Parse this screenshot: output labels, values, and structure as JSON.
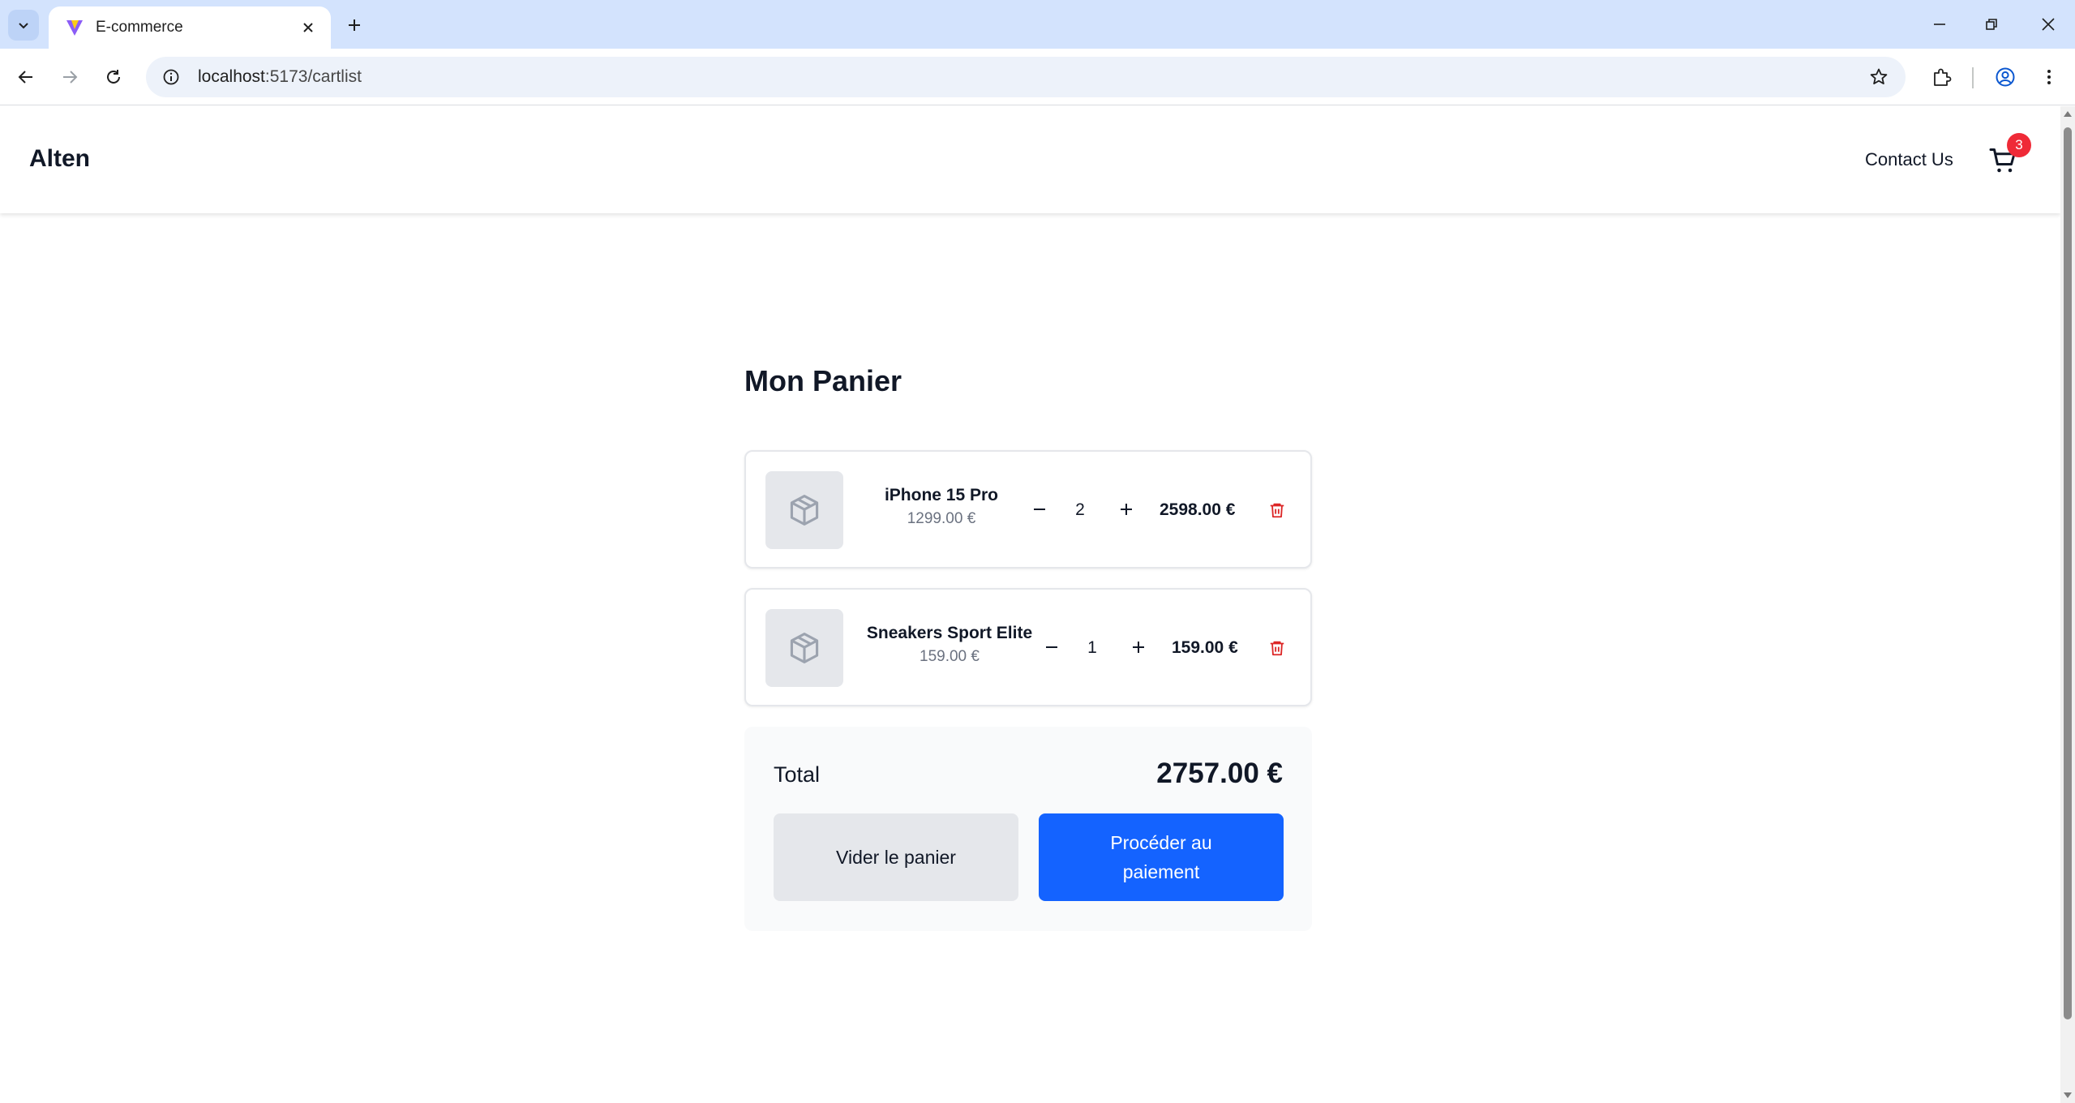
{
  "browser": {
    "tab_title": "E-commerce",
    "url_host": "localhost",
    "url_path": ":5173/cartlist"
  },
  "header": {
    "brand": "Alten",
    "contact_label": "Contact Us",
    "cart_count": "3"
  },
  "cart": {
    "title": "Mon Panier",
    "items": [
      {
        "name": "iPhone 15 Pro",
        "unit_price": "1299.00 €",
        "quantity": "2",
        "line_total": "2598.00 €"
      },
      {
        "name": "Sneakers Sport Elite",
        "unit_price": "159.00 €",
        "quantity": "1",
        "line_total": "159.00 €"
      }
    ],
    "total_label": "Total",
    "total_value": "2757.00 €",
    "clear_label": "Vider le panier",
    "checkout_label": "Procéder au paiement"
  },
  "colors": {
    "accent": "#1463ff",
    "badge": "#ef2a37",
    "delete": "#dc2626"
  }
}
